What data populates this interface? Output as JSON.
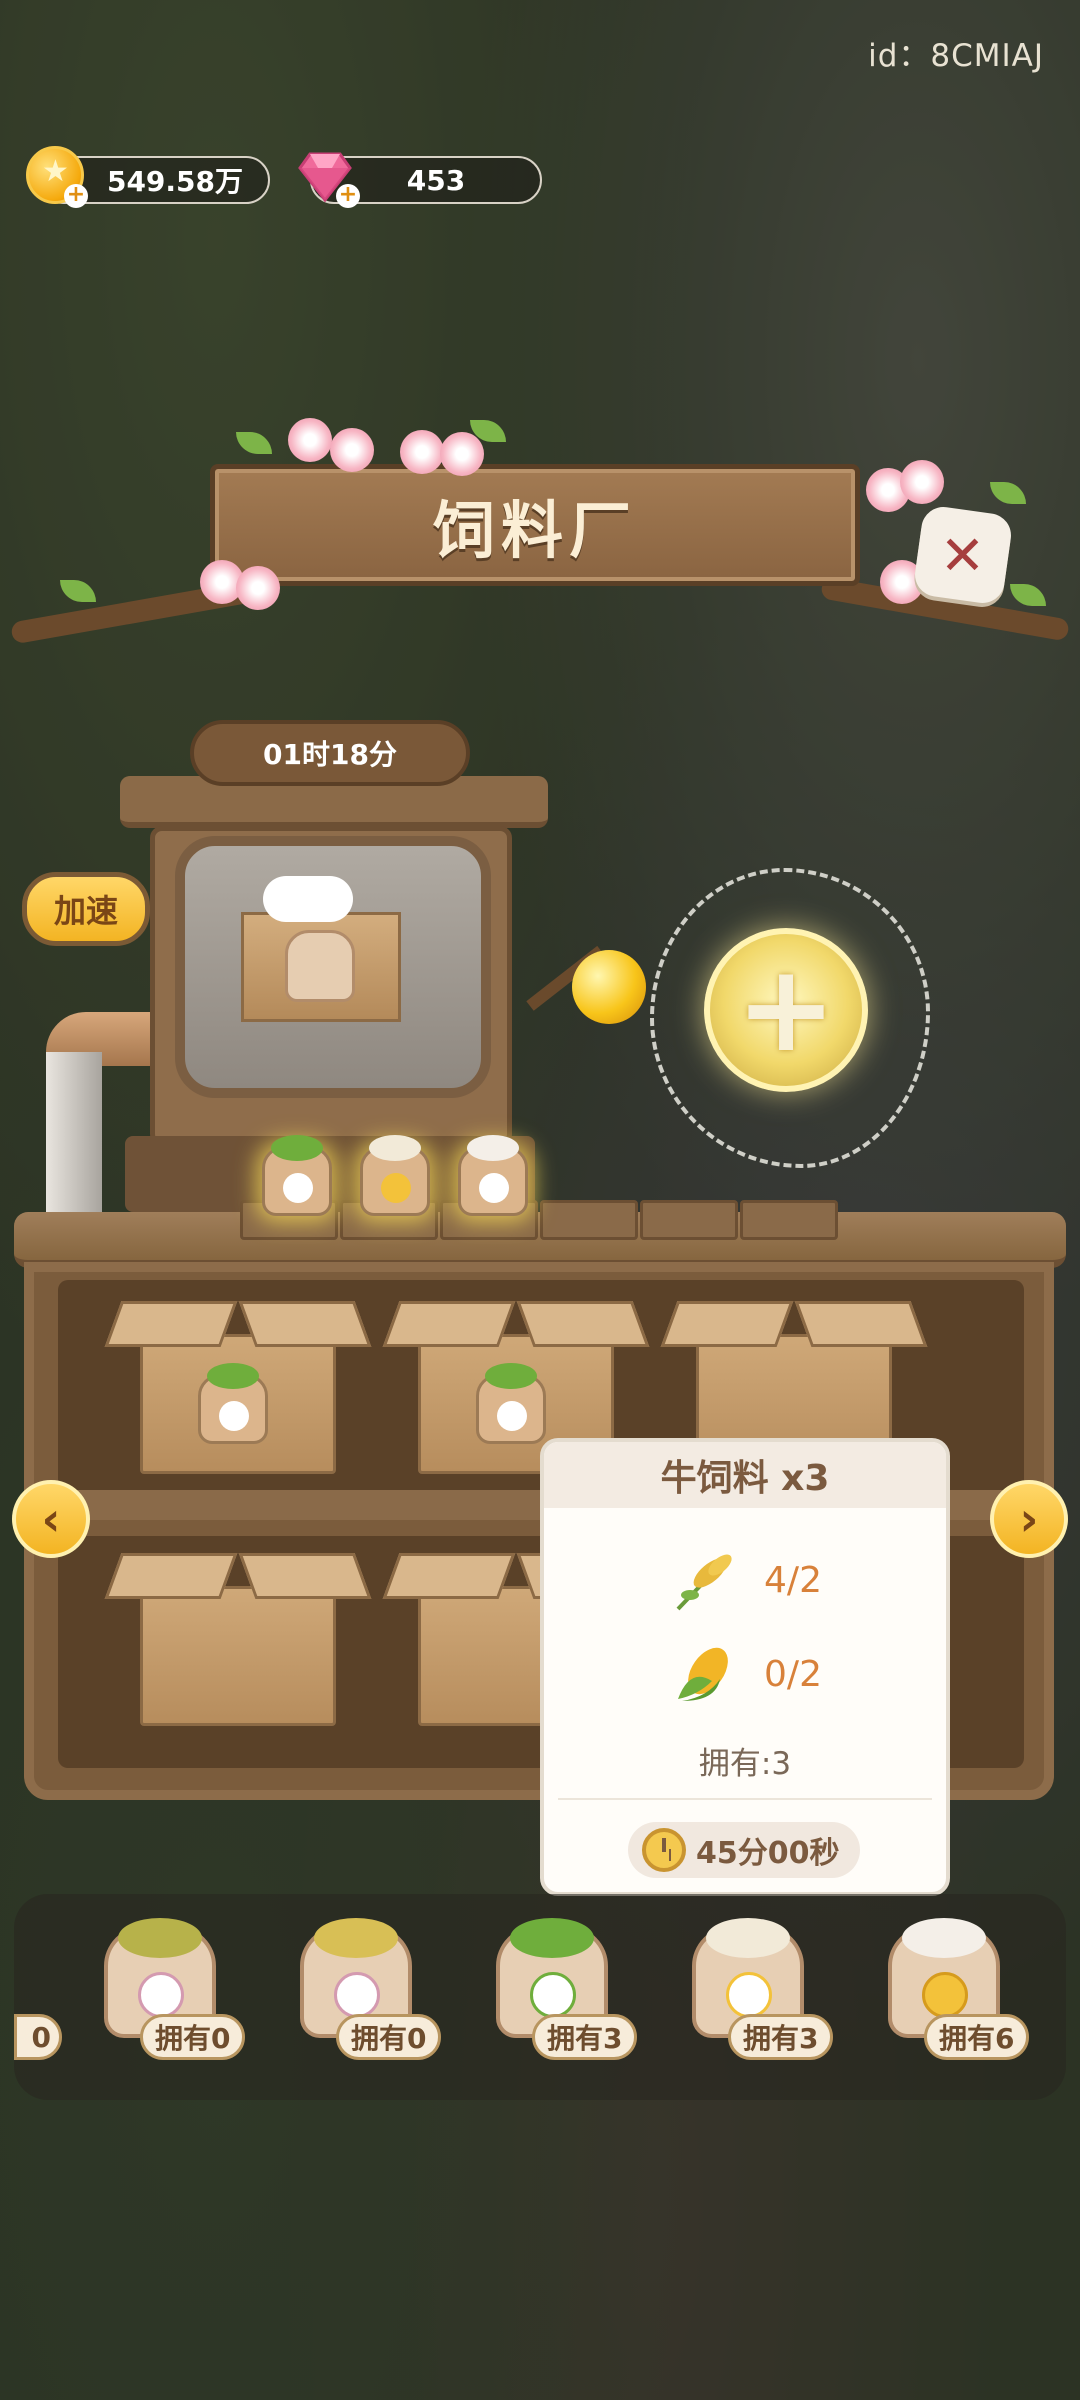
{
  "player_id": "id：8CMIAJ",
  "currency": {
    "coins": "549.58万",
    "gems": "453"
  },
  "title": "饲料厂",
  "machine": {
    "timer": "01时18分",
    "speed_up_label": "加速"
  },
  "popup": {
    "title": "牛饲料 x3",
    "requirements": [
      {
        "icon": "wheat-icon",
        "count": "4/2"
      },
      {
        "icon": "corn-icon",
        "count": "0/2"
      }
    ],
    "owned": "拥有:3",
    "time": "45分00秒"
  },
  "inventory": {
    "partial_label": "0",
    "items": [
      {
        "icon": "grass-feed-sack-icon",
        "count": "拥有0",
        "fill": "#b7b24a"
      },
      {
        "icon": "grain-feed-sack-icon",
        "count": "拥有0",
        "fill": "#d8bf55"
      },
      {
        "icon": "cow-feed-sack-icon",
        "count": "拥有3",
        "fill": "#6fae3c"
      },
      {
        "icon": "chicken-feed-sack-icon",
        "count": "拥有3",
        "fill": "#f2ead8"
      },
      {
        "icon": "pig-feed-sack-icon",
        "count": "拥有6",
        "fill": "#f4efe8"
      }
    ]
  },
  "colors": {
    "accent": "#f3b423",
    "wood": "#8a6441",
    "count_orange": "#d8813a"
  }
}
